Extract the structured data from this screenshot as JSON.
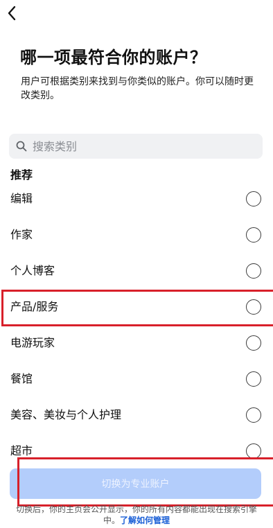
{
  "header": {
    "title": "哪一项最符合你的账户？",
    "subtitle": "用户可根据类别来找到与你类似的账户。你可以随时更改类别。"
  },
  "search": {
    "placeholder": "搜索类别"
  },
  "section": {
    "title": "推荐"
  },
  "categories": [
    {
      "label": "编辑",
      "selected": false
    },
    {
      "label": "作家",
      "selected": false
    },
    {
      "label": "个人博客",
      "selected": false
    },
    {
      "label": "产品/服务",
      "selected": false
    },
    {
      "label": "电游玩家",
      "selected": false
    },
    {
      "label": "餐馆",
      "selected": false
    },
    {
      "label": "美容、美妆与个人护理",
      "selected": false
    },
    {
      "label": "超市",
      "selected": false
    }
  ],
  "actions": {
    "switch_label": "切换为专业账户"
  },
  "footer": {
    "text": "切换后，你的主页会公开显示，你的所有内容都能出现在搜索引擎中。",
    "link": "了解如何管理"
  },
  "colors": {
    "button_bg": "#b3cdfb",
    "link": "#1a5fd6",
    "highlight": "#d8202a"
  }
}
